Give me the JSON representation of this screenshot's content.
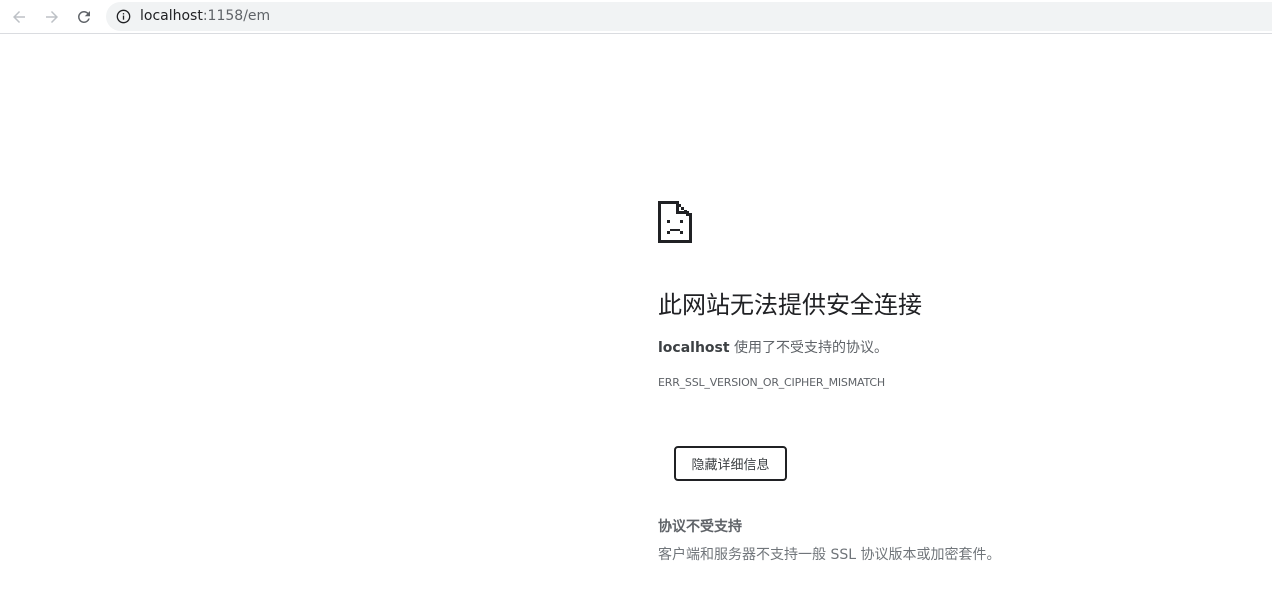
{
  "browser": {
    "url_host": "localhost",
    "url_path": ":1158/em",
    "icons": {
      "back": "arrow-left-icon",
      "forward": "arrow-right-icon",
      "reload": "reload-icon",
      "site_info": "info-icon"
    }
  },
  "error_page": {
    "icon": "sad-document-icon",
    "heading": "此网站无法提供安全连接",
    "desc_host": "localhost",
    "desc_text": " 使用了不受支持的协议。",
    "error_code": "ERR_SSL_VERSION_OR_CIPHER_MISMATCH",
    "details_button_label": "隐藏详细信息",
    "details_heading": "协议不受支持",
    "details_body": "客户端和服务器不支持一般 SSL 协议版本或加密套件。"
  },
  "colors": {
    "text_primary": "#202124",
    "text_secondary": "#5f6368",
    "omnibox_bg": "#f1f3f4",
    "nav_icon_disabled": "#bdc1c6",
    "nav_icon_enabled": "#5f6368"
  }
}
